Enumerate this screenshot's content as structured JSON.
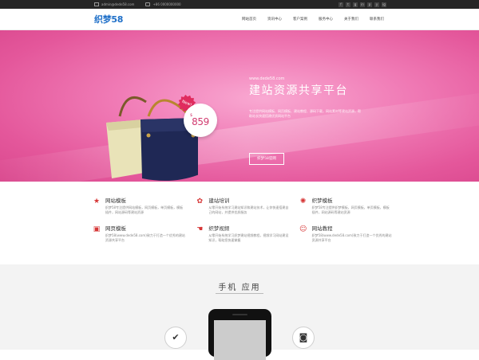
{
  "topbar": {
    "email": "admin@dede58.com",
    "phone": "+86 0000000000",
    "social": [
      "f",
      "t",
      "g",
      "in",
      "p",
      "y",
      "ig"
    ]
  },
  "nav": {
    "logo": "织梦58",
    "menu": [
      "网站首页",
      "资讯中心",
      "客户案例",
      "服务中心",
      "关于我们",
      "联系我们"
    ]
  },
  "hero": {
    "url": "www.dede58.com",
    "title": "建站资源共享平台",
    "desc": "专注提供网站模板、网页模板、建站教程、源码下载，网站素材等建站资源，帮助站长快速搭建优质网站平台",
    "button": "织梦58官网",
    "badge": "New!",
    "currency": "$",
    "price": "859"
  },
  "features": [
    {
      "icon": "star-icon",
      "glyph": "★",
      "title": "网站模板",
      "desc": "织梦58专注提供网站模板，网页模板，单页模板，模板插件，网站源码等建站资源"
    },
    {
      "icon": "leaf-icon",
      "glyph": "✿",
      "title": "建站培训",
      "desc": "从零开始系统学习建站知识和建站技术，让你快速搭建自己的网站，并提供优质服务"
    },
    {
      "icon": "gear-icon",
      "glyph": "✺",
      "title": "织梦模板",
      "desc": "织梦58专注提供织梦模板，网页模板，单页模板，模板插件，网站源码等建站资源"
    },
    {
      "icon": "image-icon",
      "glyph": "▣",
      "title": "网页模板",
      "desc": "织梦58(www.dede58.com)致力于打造一个优秀的建站资源共享平台"
    },
    {
      "icon": "hand-icon",
      "glyph": "☚",
      "title": "织梦视频",
      "desc": "从零开始系统学习织梦建站视频教程，视频学习网站建设知识，帮助您快速掌握"
    },
    {
      "icon": "smile-icon",
      "glyph": "☺",
      "title": "网站教程",
      "desc": "织梦58(www.dede58.com)致力于打造一个优秀的建站资源共享平台"
    }
  ],
  "apps": {
    "heading": "手机 应用"
  },
  "colors": {
    "accent": "#e4579b",
    "icon": "#d63636",
    "logo": "#1e6fc8"
  }
}
